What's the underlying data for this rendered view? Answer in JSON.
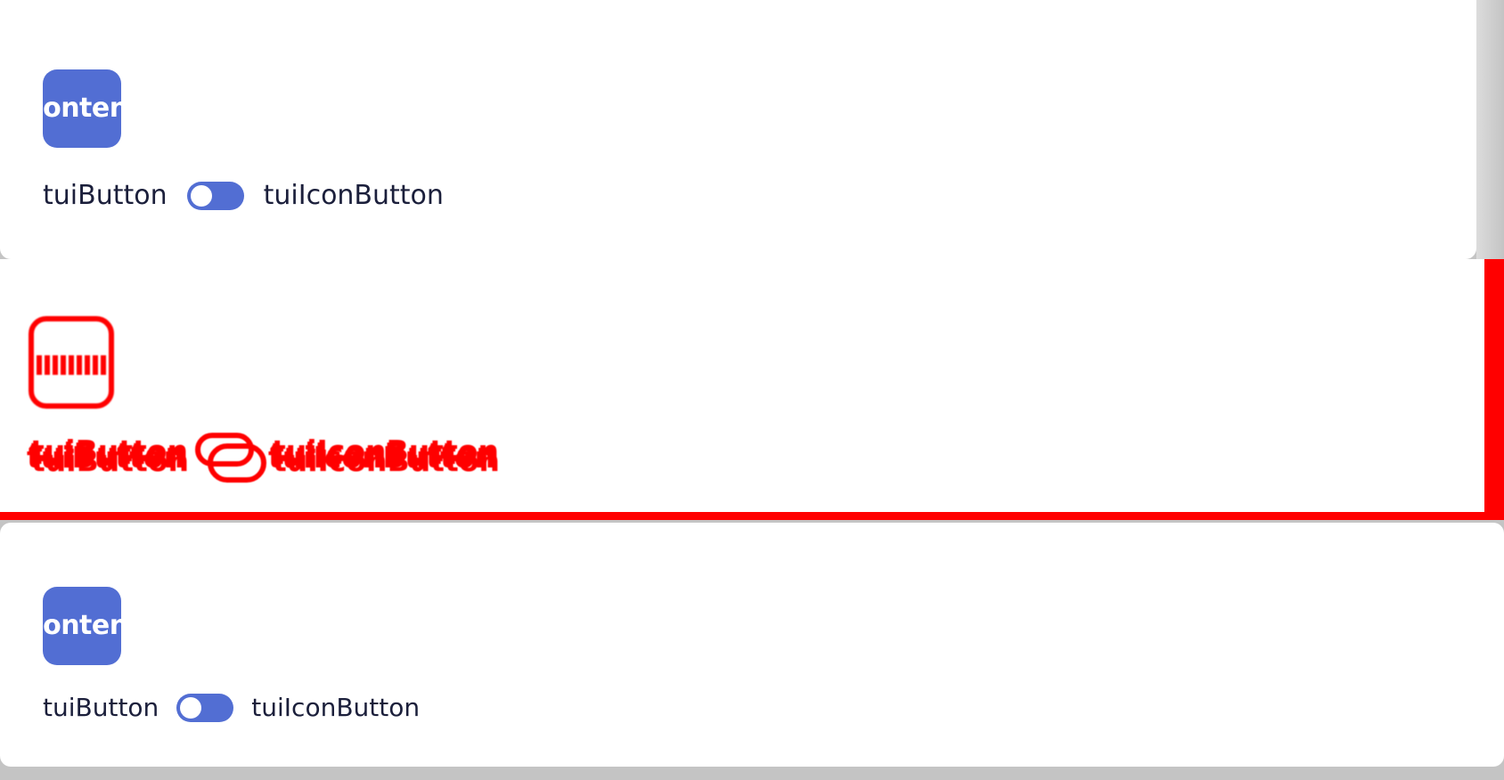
{
  "panels": {
    "top": {
      "content_button_label": "Content",
      "left_label": "tuiButton",
      "right_label": "tuiIconButton",
      "toggle_state": "off"
    },
    "diff": {
      "content_button_label": "Content",
      "left_label": "tuiButton",
      "right_label": "tuiIconButton"
    },
    "bottom": {
      "content_button_label": "Content",
      "left_label": "tuiButton",
      "right_label": "tuiIconButton",
      "toggle_state": "off"
    }
  },
  "colors": {
    "accent": "#526ed3",
    "diff_highlight": "#ff0000",
    "background": "#c4c4c4",
    "panel": "#ffffff",
    "text": "#1b1f3b"
  }
}
